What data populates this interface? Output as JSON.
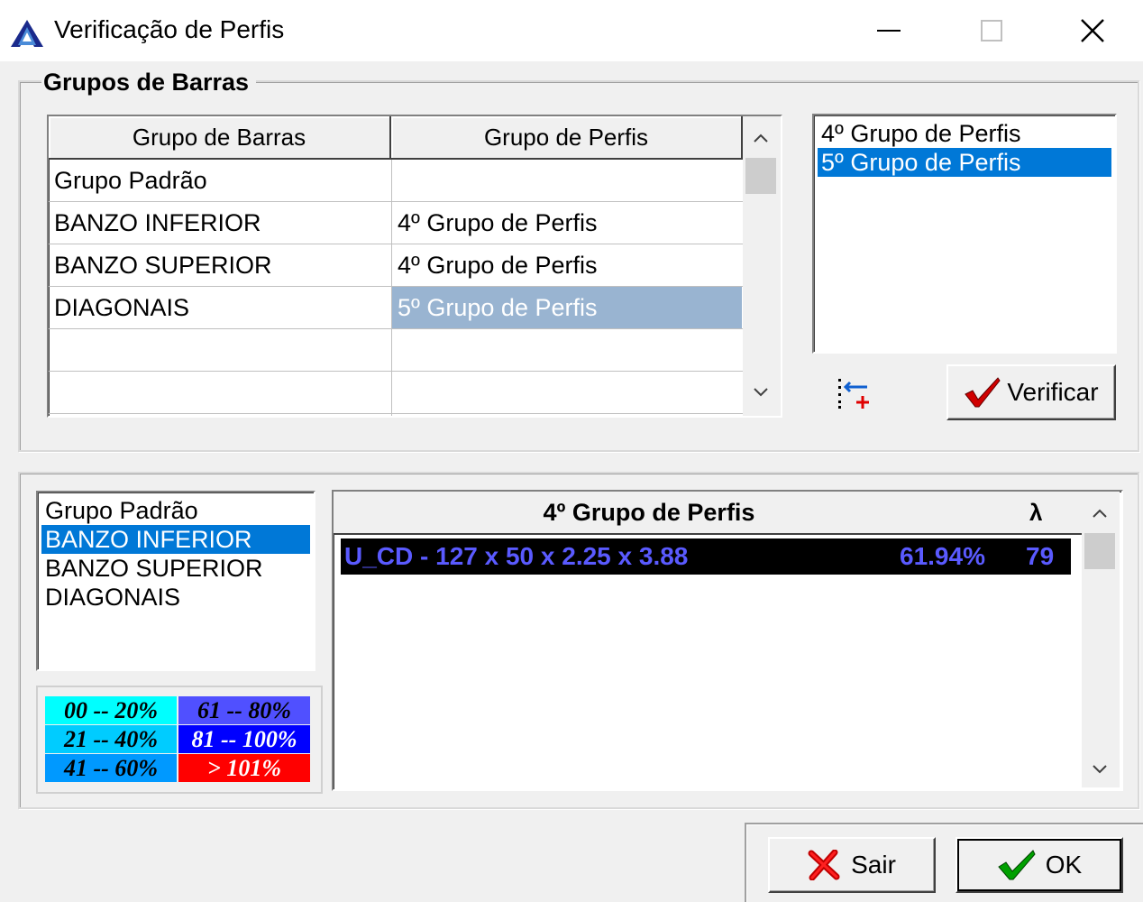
{
  "window": {
    "title": "Verificação de Perfis"
  },
  "group_box": {
    "title": "Grupos de Barras"
  },
  "grid": {
    "headers": [
      "Grupo de Barras",
      "Grupo de Perfis"
    ],
    "rows": [
      [
        "Grupo Padrão",
        ""
      ],
      [
        "BANZO INFERIOR",
        "4º Grupo de Perfis"
      ],
      [
        "BANZO SUPERIOR",
        "4º Grupo de Perfis"
      ],
      [
        "DIAGONAIS",
        "5º Grupo de Perfis"
      ],
      [
        "",
        ""
      ],
      [
        "",
        ""
      ]
    ],
    "selected_row": 3
  },
  "profile_groups": {
    "items": [
      "4º Grupo de Perfis",
      "5º Grupo de Perfis"
    ],
    "selected_index": 1
  },
  "buttons": {
    "verificar": "Verificar",
    "sair": "Sair",
    "ok": "OK"
  },
  "bar_groups": {
    "items": [
      "Grupo Padrão",
      "BANZO INFERIOR",
      "BANZO SUPERIOR",
      "DIAGONAIS"
    ],
    "selected_index": 1
  },
  "legend": [
    {
      "label": "00 -- 20%",
      "bg": "#00ffff",
      "fg": "#000000"
    },
    {
      "label": "61 -- 80%",
      "bg": "#5050ff",
      "fg": "#000000"
    },
    {
      "label": "21 -- 40%",
      "bg": "#00ccff",
      "fg": "#000000"
    },
    {
      "label": "81 -- 100%",
      "bg": "#0000ff",
      "fg": "#ffffff"
    },
    {
      "label": "41 -- 60%",
      "bg": "#0099ff",
      "fg": "#000000"
    },
    {
      "label": "> 101%",
      "bg": "#ff0000",
      "fg": "#ffffff"
    }
  ],
  "results": {
    "header_title": "4º Grupo de Perfis",
    "header_lambda": "λ",
    "rows": [
      {
        "profile": "U_CD - 127 x 50 x 2.25 x 3.88",
        "percent": "61.94%",
        "lambda": "79"
      }
    ]
  },
  "colors": {
    "selection": "#0078d7",
    "grid_selection": "#99b4d1",
    "result_row_bg": "#000000",
    "result_row_fg": "#5a5aff"
  }
}
